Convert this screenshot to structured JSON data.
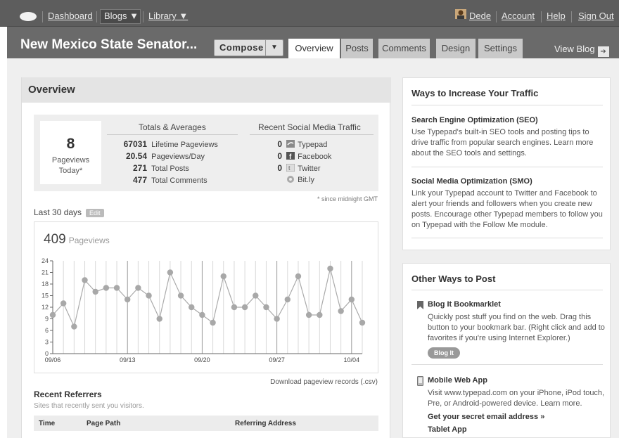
{
  "topbar": {
    "dashboard": "Dashboard",
    "blogs": "Blogs ▼",
    "library": "Library ▼",
    "user": "Dede",
    "account": "Account",
    "help": "Help",
    "signout": "Sign Out"
  },
  "nav": {
    "blog_title": "New Mexico State Senator...",
    "compose": "Compose",
    "compose_arrow": "▼",
    "tabs": [
      "Overview",
      "Posts",
      "Comments",
      "Design",
      "Settings"
    ],
    "view_blog": "View Blog",
    "view_blog_arrow": "➔"
  },
  "overview": {
    "title": "Overview",
    "today_count": "8",
    "today_label": "Pageviews Today*",
    "totals_header": "Totals & Averages",
    "totals": [
      {
        "value": "67031",
        "label": "Lifetime Pageviews"
      },
      {
        "value": "20.54",
        "label": "Pageviews/Day"
      },
      {
        "value": "271",
        "label": "Total Posts"
      },
      {
        "value": "477",
        "label": "Total Comments"
      }
    ],
    "social_header": "Recent Social Media Traffic",
    "social": [
      {
        "value": "0",
        "label": "Typepad"
      },
      {
        "value": "0",
        "label": "Facebook"
      },
      {
        "value": "0",
        "label": "Twitter"
      },
      {
        "value": "",
        "label": "Bit.ly"
      }
    ],
    "since_note": "* since midnight GMT",
    "last30": "Last 30 days",
    "edit": "Edit",
    "pageviews_total": "409",
    "pageviews_label": "Pageviews",
    "download": "Download pageview records (.csv)",
    "referrers_title": "Recent Referrers",
    "referrers_sub": "Sites that recently sent you visitors.",
    "ref_columns": [
      "Time",
      "Page Path",
      "Referring Address"
    ]
  },
  "chart_data": {
    "type": "line",
    "y_ticks": [
      "0",
      "3",
      "6",
      "9",
      "12",
      "15",
      "18",
      "21",
      "24"
    ],
    "ylim": [
      0,
      24
    ],
    "x_tick_labels": [
      {
        "index": 0,
        "label": "09/06"
      },
      {
        "index": 7,
        "label": "09/13"
      },
      {
        "index": 14,
        "label": "09/20"
      },
      {
        "index": 21,
        "label": "09/27"
      },
      {
        "index": 28,
        "label": "10/04"
      }
    ],
    "values": [
      10,
      13,
      7,
      19,
      16,
      17,
      17,
      14,
      17,
      15,
      9,
      21,
      15,
      12,
      10,
      8,
      20,
      12,
      12,
      15,
      12,
      9,
      14,
      20,
      10,
      10,
      22,
      11,
      14,
      8
    ],
    "grid": true
  },
  "sidebar": {
    "traffic_title": "Ways to Increase Your Traffic",
    "seo_title": "Search Engine Optimization (SEO)",
    "seo_text": "Use Typepad's built-in SEO tools and posting tips to drive traffic from popular search engines. Learn more about the SEO tools and settings.",
    "smo_title": "Social Media Optimization (SMO)",
    "smo_text": "Link your Typepad account to Twitter and Facebook to alert your friends and followers when you create new posts. Encourage other Typepad members to follow you on Typepad with the Follow Me module.",
    "post_title": "Other Ways to Post",
    "bookmarklet_title": "Blog It Bookmarklet",
    "bookmarklet_text": "Quickly post stuff you find on the web. Drag this button to your bookmark bar. (Right click and add to favorites if you're using Internet Explorer.)",
    "blogit": "Blog It",
    "mobile_title": "Mobile Web App",
    "mobile_text": "Visit www.typepad.com on your iPhone, iPod touch, Pre, or Android-powered device. Learn more.",
    "email_link": "Get your secret email address »",
    "tablet_title": "Tablet App"
  }
}
